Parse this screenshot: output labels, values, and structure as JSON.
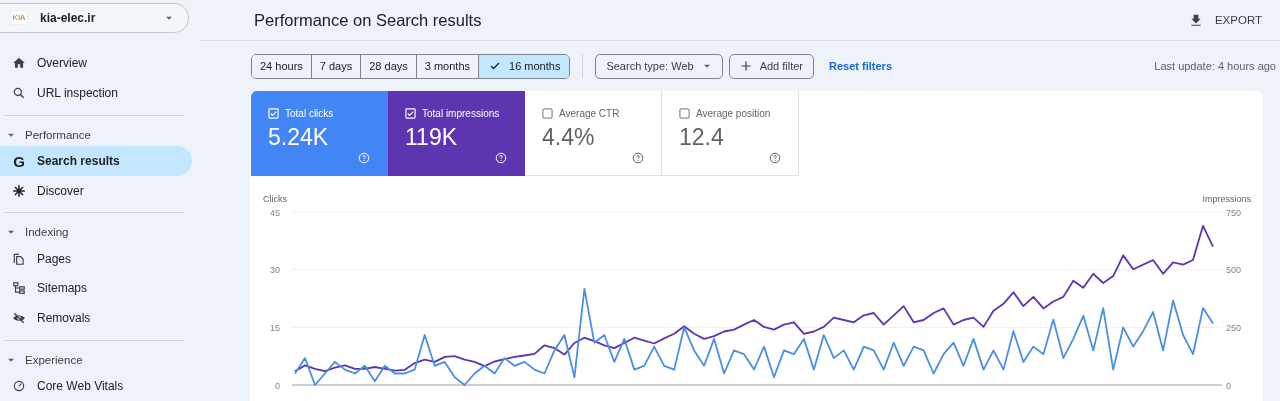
{
  "property": {
    "logo_text": "KIA",
    "name": "kia-elec.ir"
  },
  "sidebar": [
    {
      "kind": "item",
      "label": "Overview",
      "selected": false
    },
    {
      "kind": "item",
      "label": "URL inspection",
      "selected": false
    },
    {
      "kind": "section",
      "label": "Performance",
      "expanded": true,
      "children": [
        {
          "icon_text": "G",
          "label": "Search results",
          "selected": true
        },
        {
          "label": "Discover",
          "selected": false
        }
      ]
    },
    {
      "kind": "section",
      "label": "Indexing",
      "expanded": true,
      "children": [
        {
          "label": "Pages",
          "selected": false
        },
        {
          "label": "Sitemaps",
          "selected": false
        },
        {
          "label": "Removals",
          "selected": false
        }
      ]
    },
    {
      "kind": "section",
      "label": "Experience",
      "expanded": true,
      "children": [
        {
          "label": "Core Web Vitals",
          "selected": false
        }
      ]
    }
  ],
  "page_title": "Performance on Search results",
  "export_label": "EXPORT",
  "date_ranges": [
    {
      "label": "24 hours",
      "selected": false
    },
    {
      "label": "7 days",
      "selected": false
    },
    {
      "label": "28 days",
      "selected": false
    },
    {
      "label": "3 months",
      "selected": false
    },
    {
      "label": "16 months",
      "selected": true
    }
  ],
  "search_type": "Search type: Web",
  "add_filter": "Add filter",
  "reset_filters": "Reset filters",
  "last_update": "Last update: 4 hours ago",
  "metrics": [
    {
      "label": "Total clicks",
      "value": "5.24K",
      "selected": true,
      "color": "#4285f4"
    },
    {
      "label": "Total impressions",
      "value": "119K",
      "selected": true,
      "color": "#5e35b1"
    },
    {
      "label": "Average CTR",
      "value": "4.4%",
      "selected": false
    },
    {
      "label": "Average position",
      "value": "12.4",
      "selected": false
    }
  ],
  "chart_data": {
    "type": "line",
    "ylabel": "Clicks",
    "ylim": [
      0,
      45
    ],
    "yticks": [
      0,
      15,
      30,
      45
    ],
    "y2label": "Impressions",
    "y2lim": [
      0,
      750
    ],
    "y2ticks": [
      0,
      250,
      500,
      750
    ],
    "series": [
      {
        "color": "#5e35b1",
        "axis": "y2",
        "values": [
          60,
          85,
          70,
          60,
          75,
          85,
          70,
          70,
          78,
          70,
          62,
          66,
          95,
          110,
          100,
          122,
          125,
          110,
          100,
          82,
          102,
          112,
          122,
          128,
          135,
          172,
          160,
          132,
          182,
          205,
          190,
          172,
          160,
          182,
          205,
          192,
          180,
          202,
          222,
          255,
          222,
          200,
          212,
          232,
          240,
          262,
          282,
          252,
          240,
          262,
          272,
          222,
          232,
          252,
          292,
          282,
          272,
          302,
          312,
          262,
          302,
          342,
          272,
          282,
          312,
          332,
          262,
          282,
          292,
          252,
          322,
          352,
          402,
          342,
          382,
          332,
          362,
          382,
          452,
          422,
          482,
          442,
          472,
          562,
          502,
          522,
          542,
          482,
          532,
          522,
          542,
          690,
          600
        ]
      },
      {
        "color": "#4a90e2",
        "values": [
          3,
          7,
          0,
          3,
          6,
          4,
          3,
          5,
          1,
          5,
          3,
          3,
          4,
          13,
          5,
          6,
          2,
          0,
          3,
          5,
          3,
          7,
          5,
          6,
          4,
          3,
          9,
          13,
          2,
          25,
          11,
          13,
          6,
          12,
          4,
          5,
          10,
          5,
          4,
          15,
          9,
          5,
          12,
          3,
          9,
          8,
          4,
          10,
          2,
          9,
          8,
          12,
          4,
          13,
          7,
          9,
          4,
          10,
          9,
          4,
          11,
          5,
          10,
          9,
          3,
          8,
          11,
          5,
          12,
          4,
          9,
          4,
          14,
          6,
          10,
          8,
          17,
          7,
          12,
          18,
          9,
          20,
          4,
          15,
          10,
          14,
          19,
          9,
          22,
          13,
          8,
          20,
          16
        ]
      }
    ]
  }
}
